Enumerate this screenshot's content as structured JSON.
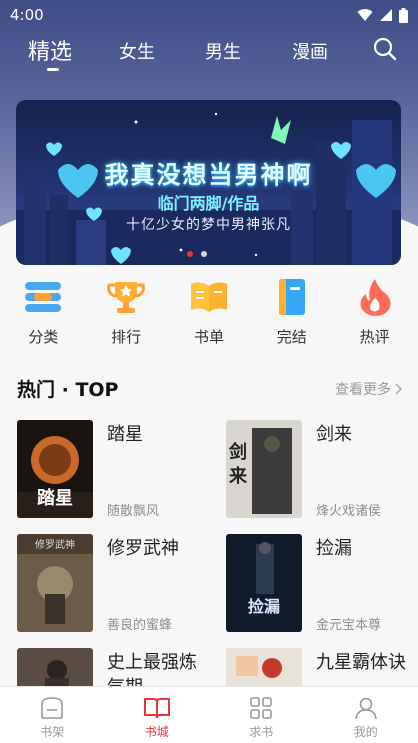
{
  "status_bar": {
    "time": "4:00"
  },
  "top_nav": {
    "tabs": [
      {
        "label": "精选",
        "active": true
      },
      {
        "label": "女生",
        "active": false
      },
      {
        "label": "男生",
        "active": false
      },
      {
        "label": "漫画",
        "active": false
      }
    ],
    "search_icon": "search-icon"
  },
  "banner": {
    "title": "我真没想当男神啊",
    "author_line": "临门两脚/作品",
    "subtitle": "十亿少女的梦中男神张凡",
    "dots_total": 2,
    "dot_active_index": 0
  },
  "categories": [
    {
      "label": "分类",
      "icon": "category-icon"
    },
    {
      "label": "排行",
      "icon": "trophy-icon"
    },
    {
      "label": "书单",
      "icon": "book-list-icon"
    },
    {
      "label": "完结",
      "icon": "completed-book-icon"
    },
    {
      "label": "热评",
      "icon": "flame-icon"
    }
  ],
  "hot_section": {
    "title": "热门 · TOP",
    "more_label": "查看更多",
    "books": [
      {
        "title": "踏星",
        "author": "随散飘风"
      },
      {
        "title": "剑来",
        "author": "烽火戏诸侯"
      },
      {
        "title": "修罗武神",
        "author": "善良的蜜蜂"
      },
      {
        "title": "捡漏",
        "author": "金元宝本尊"
      },
      {
        "title": "史上最强炼气期",
        "author": ""
      },
      {
        "title": "九星霸体诀",
        "author": ""
      }
    ]
  },
  "tabbar": {
    "items": [
      {
        "label": "书架",
        "icon": "bookshelf-icon",
        "active": false
      },
      {
        "label": "书城",
        "icon": "open-book-icon",
        "active": true
      },
      {
        "label": "求书",
        "icon": "grid-icon",
        "active": false
      },
      {
        "label": "我的",
        "icon": "profile-icon",
        "active": false
      }
    ]
  },
  "colors": {
    "accent": "#e8333b",
    "header": "#56639a"
  }
}
